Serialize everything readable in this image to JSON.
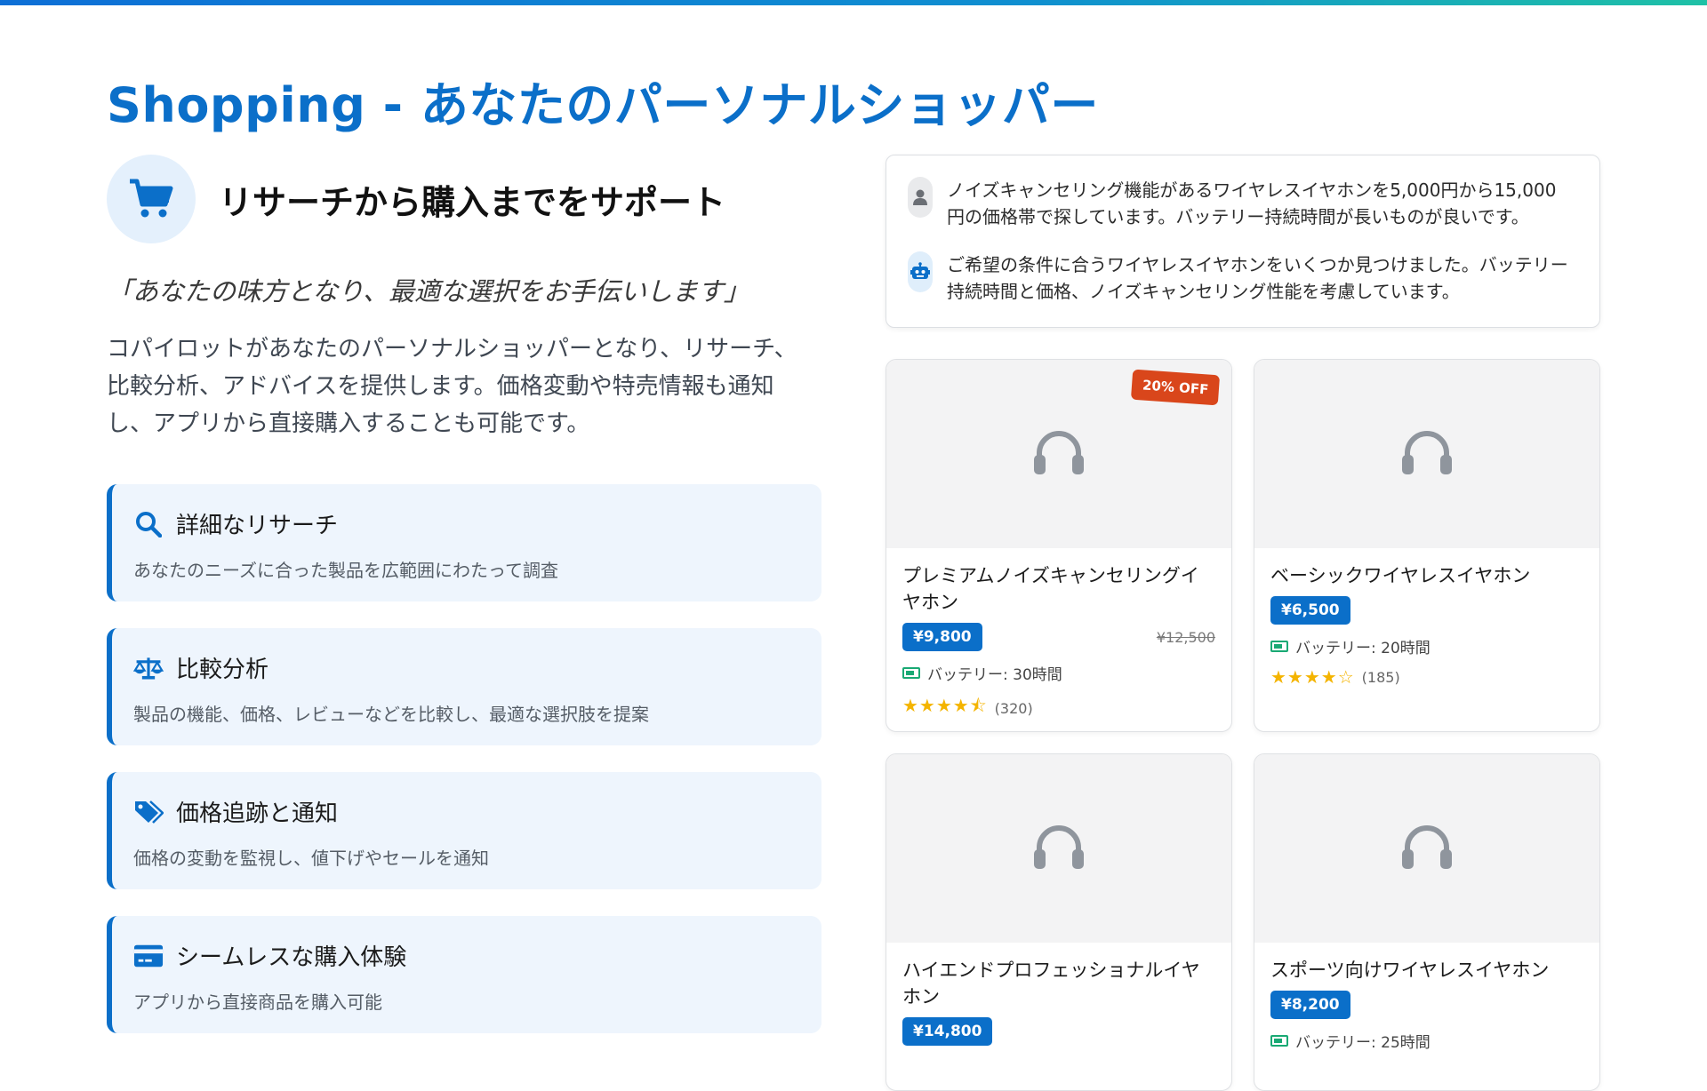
{
  "title": "Shopping - あなたのパーソナルショッパー",
  "hero": {
    "title": "リサーチから購入までをサポート"
  },
  "quote": "「あなたの味方となり、最適な選択をお手伝いします」",
  "description": "コパイロットがあなたのパーソナルショッパーとなり、リサーチ、比較分析、アドバイスを提供します。価格変動や特売情報も通知し、アプリから直接購入することも可能です。",
  "features": [
    {
      "icon": "search-icon",
      "title": "詳細なリサーチ",
      "desc": "あなたのニーズに合った製品を広範囲にわたって調査"
    },
    {
      "icon": "scale-icon",
      "title": "比較分析",
      "desc": "製品の機能、価格、レビューなどを比較し、最適な選択肢を提案"
    },
    {
      "icon": "tags-icon",
      "title": "価格追跡と通知",
      "desc": "価格の変動を監視し、値下げやセールを通知"
    },
    {
      "icon": "credit-card-icon",
      "title": "シームレスな購入体験",
      "desc": "アプリから直接商品を購入可能"
    }
  ],
  "chat": {
    "user": "ノイズキャンセリング機能があるワイヤレスイヤホンを5,000円から15,000円の価格帯で探しています。バッテリー持続時間が長いものが良いです。",
    "bot": "ご希望の条件に合うワイヤレスイヤホンをいくつか見つけました。バッテリー持続時間と価格、ノイズキャンセリング性能を考慮しています。"
  },
  "products": [
    {
      "name": "プレミアムノイズキャンセリングイヤホン",
      "price": "¥9,800",
      "old_price": "¥12,500",
      "discount": "20% OFF",
      "battery": "バッテリー: 30時間",
      "stars": "★★★★⯪",
      "rating_value": 4.5,
      "reviews": "(320)"
    },
    {
      "name": "ベーシックワイヤレスイヤホン",
      "price": "¥6,500",
      "battery": "バッテリー: 20時間",
      "stars": "★★★★☆",
      "rating_value": 4.0,
      "reviews": "(185)"
    },
    {
      "name": "ハイエンドプロフェッショナルイヤホン",
      "price": "¥14,800"
    },
    {
      "name": "スポーツ向けワイヤレスイヤホン",
      "price": "¥8,200",
      "battery": "バッテリー: 25時間"
    }
  ],
  "colors": {
    "accent": "#0b6fc9",
    "discount": "#d9461b",
    "star": "#f4b400",
    "battery": "#19a974"
  }
}
